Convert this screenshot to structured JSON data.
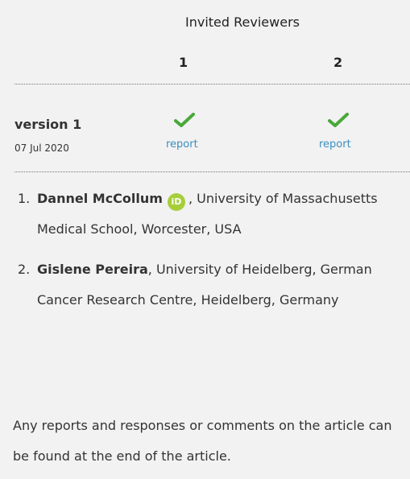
{
  "header": {
    "title": "Invited Reviewers"
  },
  "reviewer_numbers": [
    "1",
    "2"
  ],
  "version": {
    "label": "version 1",
    "date": "07 Jul 2020",
    "reports": [
      {
        "status_icon": "check-icon",
        "link": "report"
      },
      {
        "status_icon": "check-icon",
        "link": "report"
      }
    ]
  },
  "reviewers": [
    {
      "index": "1.",
      "name": "Dannel McCollum",
      "orcid": "iD",
      "affiliation": ", University of Massachusetts Medical School, Worcester, USA"
    },
    {
      "index": "2.",
      "name": "Gislene Pereira",
      "affiliation": ", University of Heidelberg, German Cancer Research Centre, Heidelberg, Germany"
    }
  ],
  "footer_note": "Any reports and responses or comments on the article can be found at the end of the article.",
  "colors": {
    "accent": "#3a8ec0",
    "check": "#4aa83a",
    "orcid": "#a6ce39",
    "background": "#f2f2f2"
  }
}
